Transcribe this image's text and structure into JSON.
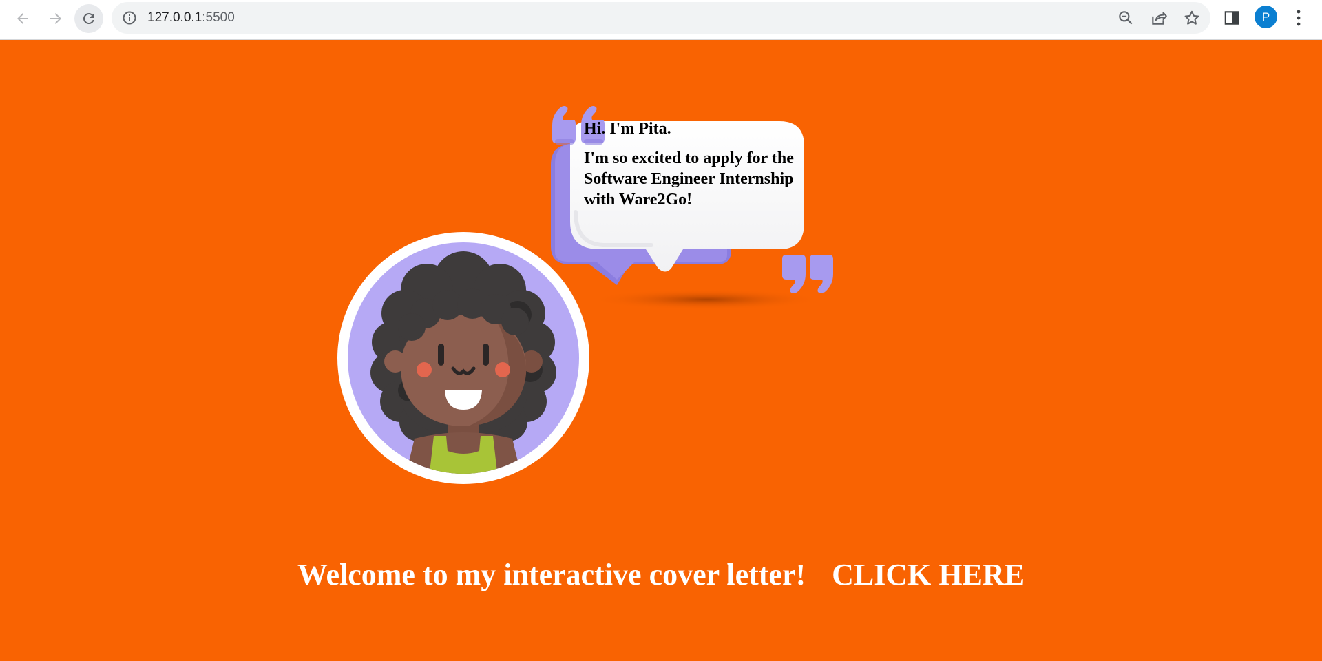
{
  "browser": {
    "url_host": "127.0.0.1",
    "url_port": ":5500",
    "profile_initial": "P",
    "icons": [
      "back-arrow-icon",
      "forward-arrow-icon",
      "reload-icon",
      "info-icon",
      "zoom-out-icon",
      "share-icon",
      "bookmark-star-icon",
      "side-panel-icon",
      "kebab-menu-icon"
    ]
  },
  "page": {
    "background_color": "#f96302",
    "bubble": {
      "greeting": "Hi. I'm Pita.",
      "message": "I'm so excited to apply for the Software Engineer Internship with Ware2Go!"
    },
    "welcome_text": "Welcome to my interactive cover letter!",
    "cta_label": "CLICK HERE"
  },
  "colors": {
    "accent_purple": "#9b8ce8",
    "skin": "#8c5e4f",
    "hair": "#3d3a3a",
    "shirt": "#a7c232"
  }
}
